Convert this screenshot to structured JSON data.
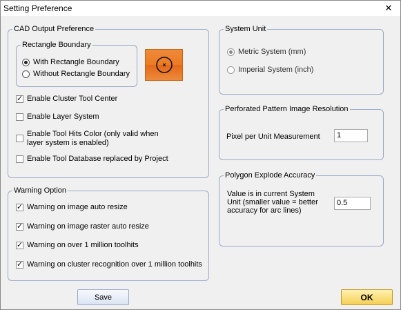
{
  "window": {
    "title": "Setting Preference",
    "close_glyph": "✕"
  },
  "cad_output": {
    "label": "CAD Output Preference",
    "rect_boundary": {
      "label": "Rectangle Boundary",
      "options": [
        {
          "label": "With Rectangle Boundary",
          "selected": true
        },
        {
          "label": "Without Rectangle Boundary",
          "selected": false
        }
      ],
      "preview_icon": "circle-with-x-icon",
      "preview_color": "#ec7a22"
    },
    "checkboxes": [
      {
        "label": "Enable Cluster Tool Center",
        "checked": true
      },
      {
        "label": "Enable Layer System",
        "checked": false
      },
      {
        "label_line1": "Enable Tool Hits Color (only valid when",
        "label_line2": "layer system is enabled)",
        "checked": false
      },
      {
        "label": "Enable Tool Database replaced by Project",
        "checked": false
      }
    ]
  },
  "warning_option": {
    "label": "Warning Option",
    "checkboxes": [
      {
        "label": "Warning on image auto resize",
        "checked": true
      },
      {
        "label": "Warning on image raster auto resize",
        "checked": true
      },
      {
        "label": "Warning on over 1 million toolhits",
        "checked": true
      },
      {
        "label": "Warning on cluster recognition over 1 million toolhits",
        "checked": true
      }
    ]
  },
  "system_unit": {
    "label": "System Unit",
    "options": [
      {
        "label": "Metric System (mm)",
        "selected": true
      },
      {
        "label": "Imperial System (inch)",
        "selected": false
      }
    ]
  },
  "resolution": {
    "label": "Perforated Pattern Image Resolution",
    "field_label": "Pixel per Unit Measurement",
    "value": "1"
  },
  "explode": {
    "label": "Polygon Explode Accuracy",
    "desc_line1": "Value is in current System",
    "desc_line2": "Unit (smaller value = better",
    "desc_line3": "accuracy for arc lines)",
    "value": "0.5"
  },
  "buttons": {
    "save": "Save",
    "ok": "OK"
  },
  "colors": {
    "ok_button": "#f5cf55",
    "group_border": "#9aa8c8"
  }
}
